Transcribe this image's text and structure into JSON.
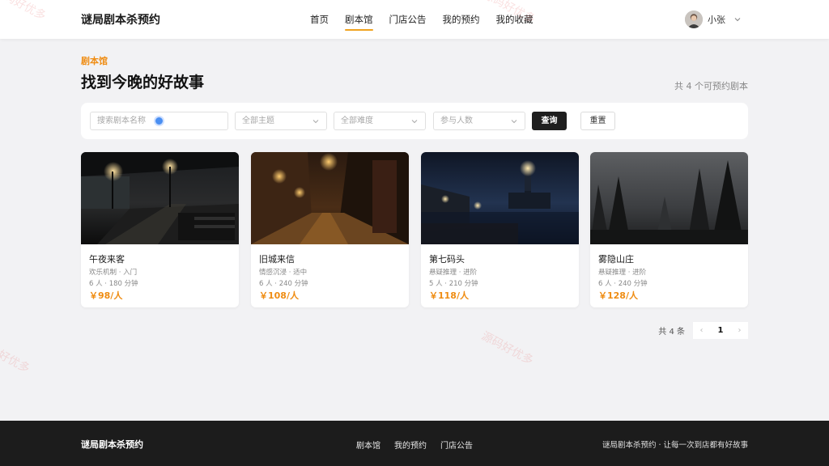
{
  "header": {
    "brand": "谜局剧本杀预约",
    "nav": [
      {
        "label": "首页",
        "active": false
      },
      {
        "label": "剧本馆",
        "active": true
      },
      {
        "label": "门店公告",
        "active": false
      },
      {
        "label": "我的预约",
        "active": false
      },
      {
        "label": "我的收藏",
        "active": false
      }
    ],
    "user": {
      "name": "小张",
      "avatar_icon": "user-avatar",
      "menu_icon": "chevron-down-icon"
    }
  },
  "page": {
    "breadcrumb": "剧本馆",
    "title": "找到今晚的好故事",
    "total_text": "共 4 个可预约剧本"
  },
  "filters": {
    "search_placeholder": "搜索剧本名称",
    "theme_placeholder": "全部主题",
    "difficulty_placeholder": "全部难度",
    "people_placeholder": "参与人数",
    "query_label": "查询",
    "reset_label": "重置"
  },
  "scripts": [
    {
      "title": "午夜来客",
      "tags": "欢乐机制 · 入门",
      "meta": "6 人 · 180 分钟",
      "price": "￥98/人",
      "image": "night-train-station"
    },
    {
      "title": "旧城来信",
      "tags": "情感沉浸 · 适中",
      "meta": "6 人 · 240 分钟",
      "price": "￥108/人",
      "image": "old-town-rainy-street"
    },
    {
      "title": "第七码头",
      "tags": "悬疑推理 · 进阶",
      "meta": "5 人 · 210 分钟",
      "price": "￥118/人",
      "image": "dock-lighthouse-night"
    },
    {
      "title": "雾隐山庄",
      "tags": "悬疑推理 · 进阶",
      "meta": "6 人 · 240 分钟",
      "price": "￥128/人",
      "image": "misty-forest"
    }
  ],
  "pagination": {
    "total": "共 4 条",
    "prev": "‹",
    "current": "1",
    "next": "›"
  },
  "footer": {
    "brand": "谜局剧本杀预约",
    "links": [
      "剧本馆",
      "我的预约",
      "门店公告"
    ],
    "slogan": "谜局剧本杀预约 · 让每一次到店都有好故事"
  },
  "watermark": "源码好优多",
  "colors": {
    "accent": "#ef8c12",
    "dark": "#1c1c1c",
    "background": "#f2f2f4"
  }
}
